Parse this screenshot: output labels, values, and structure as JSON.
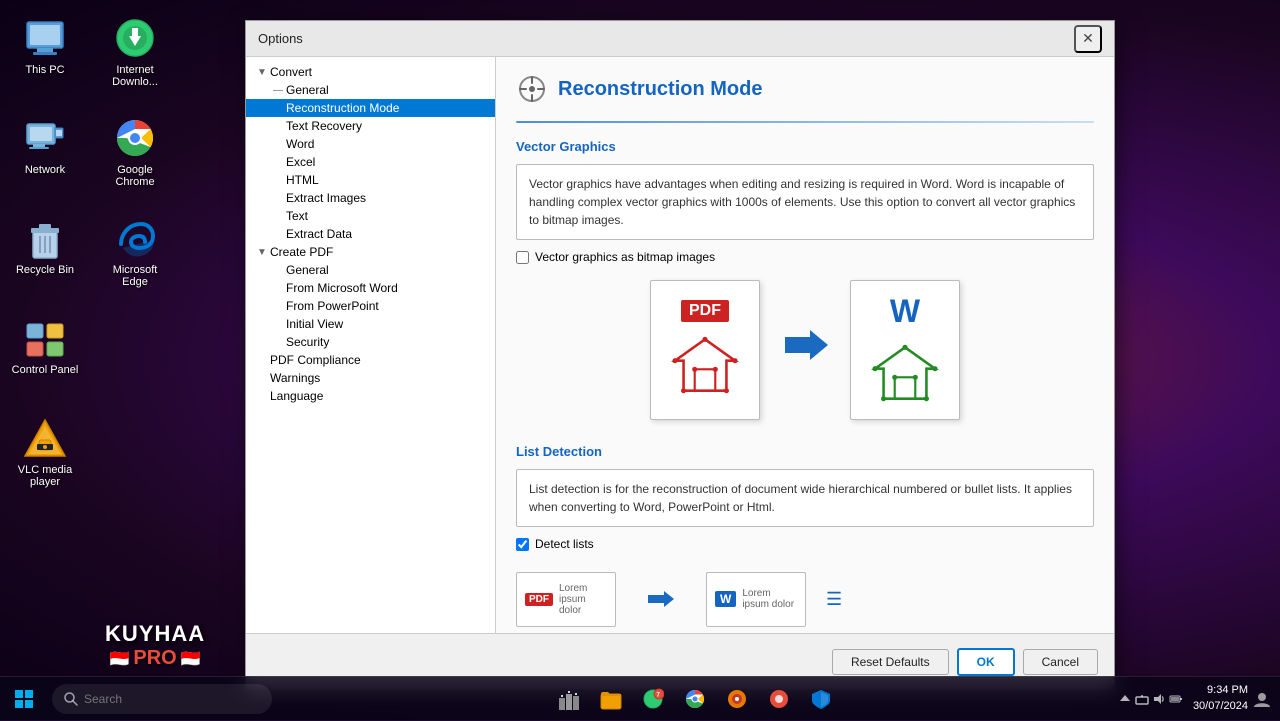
{
  "desktop": {
    "background": "radial-gradient"
  },
  "desktop_icons": [
    {
      "id": "this-pc",
      "label": "This PC",
      "icon": "💻",
      "col": 0,
      "row": 0
    },
    {
      "id": "internet-download",
      "label": "Internet Downlo...",
      "icon": "🌐",
      "col": 1,
      "row": 0
    },
    {
      "id": "network",
      "label": "Network",
      "icon": "🖥",
      "col": 0,
      "row": 1
    },
    {
      "id": "google-chrome",
      "label": "Google Chrome",
      "icon": "🔵",
      "col": 1,
      "row": 1
    },
    {
      "id": "recycle-bin",
      "label": "Recycle Bin",
      "icon": "🗑",
      "col": 0,
      "row": 2
    },
    {
      "id": "microsoft-edge",
      "label": "Microsoft Edge",
      "icon": "🔷",
      "col": 1,
      "row": 2
    },
    {
      "id": "control-panel",
      "label": "Control Panel",
      "icon": "🖥",
      "col": 0,
      "row": 3
    },
    {
      "id": "vlc",
      "label": "VLC media player",
      "icon": "🔶",
      "col": 0,
      "row": 4
    }
  ],
  "kuyhaa": {
    "title": "KUYHAA",
    "pro": "PRO",
    "flag": "🇮🇩"
  },
  "dialog": {
    "title": "Options",
    "close_btn": "✕"
  },
  "tree": {
    "items": [
      {
        "id": "convert",
        "label": "Convert",
        "indent": 1,
        "expander": "expanded",
        "selected": false
      },
      {
        "id": "general",
        "label": "General",
        "indent": 2,
        "expander": "none",
        "selected": false
      },
      {
        "id": "reconstruction-mode",
        "label": "Reconstruction Mode",
        "indent": 2,
        "expander": "none",
        "selected": true
      },
      {
        "id": "text-recovery",
        "label": "Text Recovery",
        "indent": 2,
        "expander": "none",
        "selected": false
      },
      {
        "id": "word",
        "label": "Word",
        "indent": 2,
        "expander": "none",
        "selected": false
      },
      {
        "id": "excel",
        "label": "Excel",
        "indent": 2,
        "expander": "none",
        "selected": false
      },
      {
        "id": "html",
        "label": "HTML",
        "indent": 2,
        "expander": "none",
        "selected": false
      },
      {
        "id": "extract-images",
        "label": "Extract Images",
        "indent": 2,
        "expander": "none",
        "selected": false
      },
      {
        "id": "text",
        "label": "Text",
        "indent": 2,
        "expander": "none",
        "selected": false
      },
      {
        "id": "extract-data",
        "label": "Extract Data",
        "indent": 2,
        "expander": "none",
        "selected": false
      },
      {
        "id": "create-pdf",
        "label": "Create PDF",
        "indent": 1,
        "expander": "expanded",
        "selected": false
      },
      {
        "id": "create-pdf-general",
        "label": "General",
        "indent": 2,
        "expander": "none",
        "selected": false
      },
      {
        "id": "from-word",
        "label": "From Microsoft Word",
        "indent": 2,
        "expander": "none",
        "selected": false
      },
      {
        "id": "from-powerpoint",
        "label": "From PowerPoint",
        "indent": 2,
        "expander": "none",
        "selected": false
      },
      {
        "id": "initial-view",
        "label": "Initial View",
        "indent": 2,
        "expander": "none",
        "selected": false
      },
      {
        "id": "security",
        "label": "Security",
        "indent": 2,
        "expander": "none",
        "selected": false
      },
      {
        "id": "pdf-compliance",
        "label": "PDF Compliance",
        "indent": 1,
        "expander": "none",
        "selected": false
      },
      {
        "id": "warnings",
        "label": "Warnings",
        "indent": 1,
        "expander": "none",
        "selected": false
      },
      {
        "id": "language",
        "label": "Language",
        "indent": 1,
        "expander": "none",
        "selected": false
      }
    ]
  },
  "content": {
    "section_title": "Reconstruction Mode",
    "section_icon": "⚙",
    "vector_graphics": {
      "title": "Vector Graphics",
      "description": "Vector graphics have advantages when editing and resizing is required in Word. Word is incapable of handling complex vector graphics with 1000s of elements. Use this option to convert all vector graphics to bitmap images.",
      "checkbox_label": "Vector graphics as bitmap images",
      "checkbox_checked": false
    },
    "list_detection": {
      "title": "List Detection",
      "description": "List detection is for the reconstruction of document wide hierarchical numbered or bullet lists. It applies when converting to Word, PowerPoint or Html.",
      "checkbox_label": "Detect lists",
      "checkbox_checked": true
    }
  },
  "footer": {
    "reset_label": "Reset Defaults",
    "ok_label": "OK",
    "cancel_label": "Cancel"
  },
  "taskbar": {
    "search_placeholder": "Search",
    "time": "9:34 PM",
    "date": "30/07/2024",
    "start_icon": "⊞"
  }
}
